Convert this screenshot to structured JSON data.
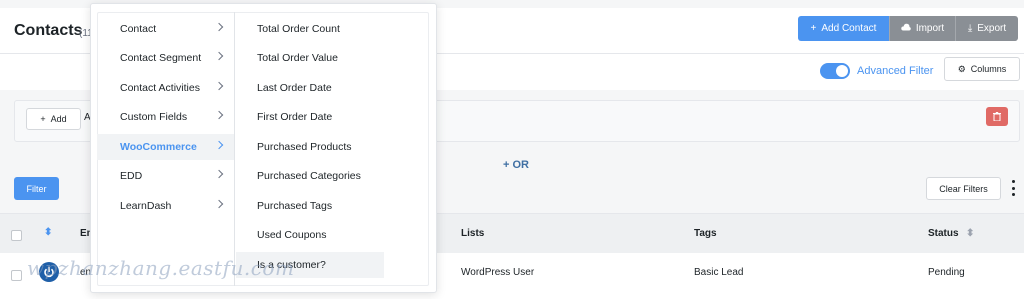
{
  "header": {
    "title": "Contacts",
    "count": "(11",
    "add_contact_label": "Add Contact",
    "import_label": "Import",
    "export_label": "Export"
  },
  "toolbar": {
    "advanced_filter_label": "Advanced Filter",
    "advanced_filter_on": true,
    "columns_label": "Columns"
  },
  "filter": {
    "add_label": "Add",
    "add_suffix": "A",
    "or_label": "OR",
    "filter_button": "Filter",
    "clear_filters": "Clear Filters"
  },
  "table": {
    "headers": [
      "En",
      "Lists",
      "Tags",
      "Status"
    ],
    "row": {
      "email": "en",
      "list": "WordPress User",
      "tag": "Basic Lead",
      "status": "Pending"
    }
  },
  "dropdown": {
    "categories": [
      {
        "label": "Contact"
      },
      {
        "label": "Contact Segment"
      },
      {
        "label": "Contact Activities"
      },
      {
        "label": "Custom Fields"
      },
      {
        "label": "WooCommerce",
        "active": true
      },
      {
        "label": "EDD"
      },
      {
        "label": "LearnDash"
      }
    ],
    "options": [
      "Total Order Count",
      "Total Order Value",
      "Last Order Date",
      "First Order Date",
      "Purchased Products",
      "Purchased Categories",
      "Purchased Tags",
      "Used Coupons",
      "Is a customer?"
    ]
  },
  "watermark": "wpzhanzhang.eastfu.com",
  "colors": {
    "accent": "#4b94f0",
    "danger": "#e06a65",
    "gray_button": "#8a8f95"
  }
}
